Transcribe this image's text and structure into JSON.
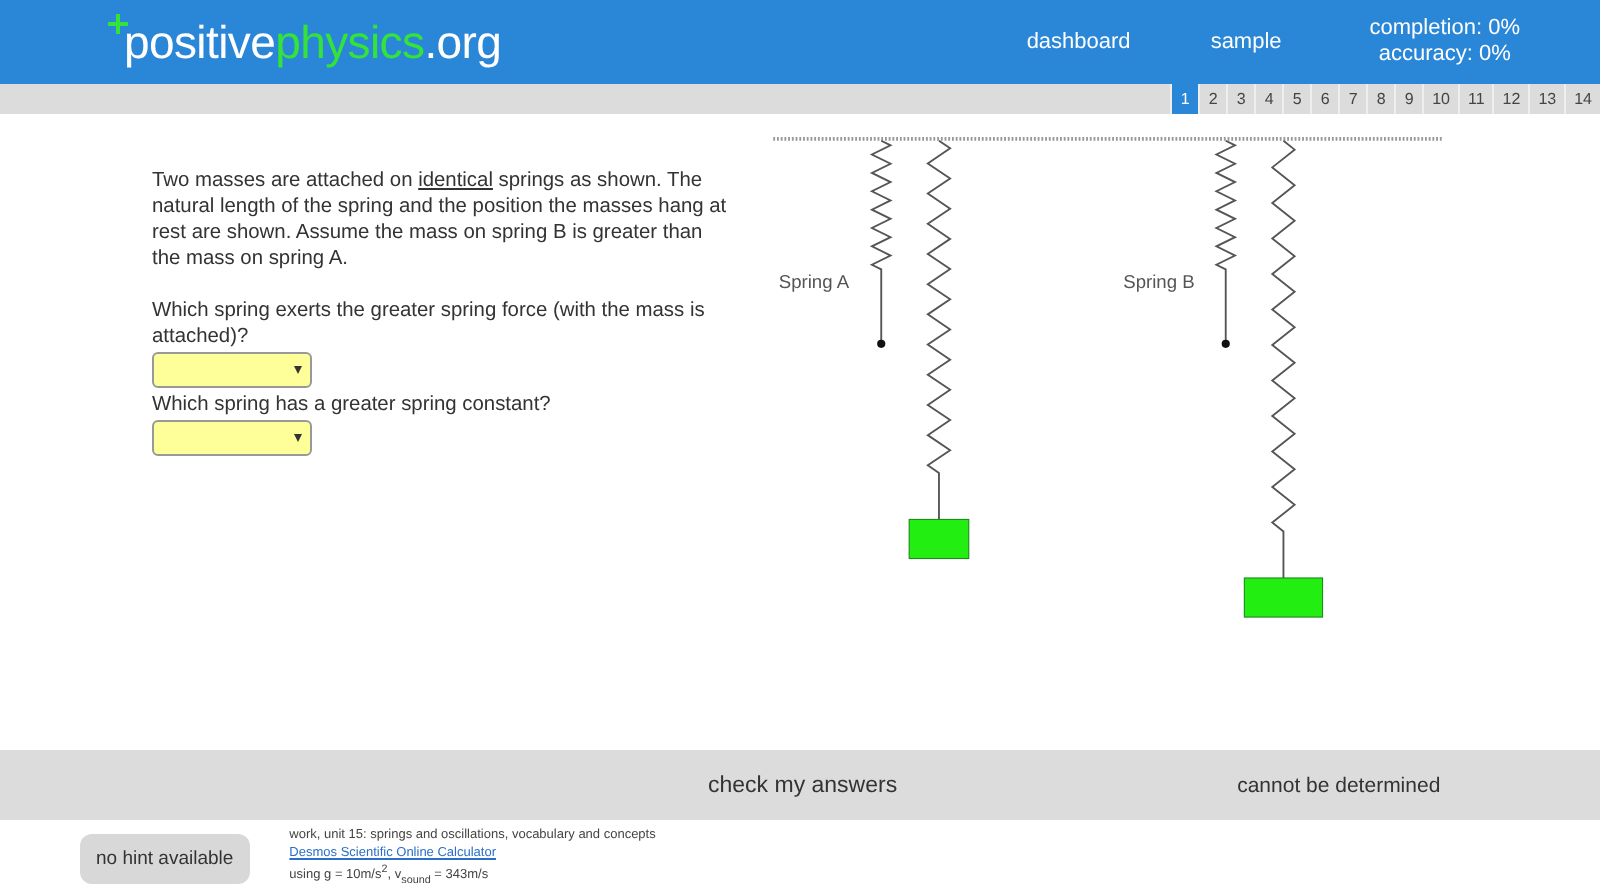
{
  "header": {
    "logo": {
      "prefix": "positive",
      "highlight": "physics",
      "suffix": ".org"
    },
    "nav": [
      {
        "label": "dashboard"
      },
      {
        "label": "sample"
      }
    ],
    "stats": [
      "completion: 0%",
      "accuracy: 0%"
    ]
  },
  "pages": [
    {
      "label": "1",
      "selected": true
    },
    {
      "label": "2",
      "selected": false
    },
    {
      "label": "3",
      "selected": false
    },
    {
      "label": "4",
      "selected": false
    },
    {
      "label": "5",
      "selected": false
    },
    {
      "label": "6",
      "selected": false
    },
    {
      "label": "7",
      "selected": false
    },
    {
      "label": "8",
      "selected": false
    },
    {
      "label": "9",
      "selected": false
    },
    {
      "label": "10",
      "selected": false
    },
    {
      "label": "11",
      "selected": false
    },
    {
      "label": "12",
      "selected": false
    },
    {
      "label": "13",
      "selected": false
    },
    {
      "label": "14",
      "selected": false
    }
  ],
  "problem": {
    "intro": {
      "before": "Two masses are attached on ",
      "underlined": "identical",
      "after": " springs as shown. The natural length of the spring and the position the masses hang at rest are shown. Assume the mass on spring B is greater than the mass on spring A."
    },
    "questions": [
      {
        "text": "Which spring exerts the greater spring force (with the mass is attached)?"
      },
      {
        "text": "Which spring has a greater spring constant?"
      }
    ]
  },
  "diagram": {
    "springs": [
      {
        "label": "Spring A"
      },
      {
        "label": "Spring B"
      }
    ]
  },
  "action_bar": {
    "check_button": "check my answers",
    "note": "cannot be determined"
  },
  "footer": {
    "hint_button": "no hint available",
    "topic": "work, unit 15: springs and oscillations, vocabulary and concepts",
    "link": "Desmos Scientific Online Calculator",
    "constants": "using g = 10m/s$^{2}$, v$_{sound}$ = 343m/s"
  }
}
